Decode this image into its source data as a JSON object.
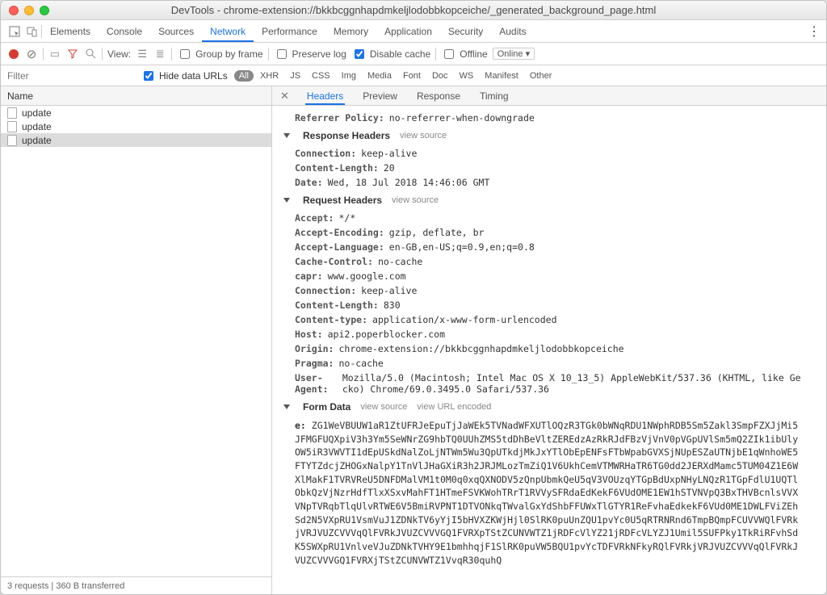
{
  "window": {
    "title": "DevTools - chrome-extension://bkkbcggnhapdmkeljlodobbkopceiche/_generated_background_page.html"
  },
  "main_tabs": [
    "Elements",
    "Console",
    "Sources",
    "Network",
    "Performance",
    "Memory",
    "Application",
    "Security",
    "Audits"
  ],
  "main_active": "Network",
  "toolbar": {
    "view_label": "View:",
    "group_by_frame": "Group by frame",
    "preserve_log": "Preserve log",
    "disable_cache": "Disable cache",
    "offline": "Offline",
    "online": "Online"
  },
  "filter": {
    "placeholder": "Filter",
    "hide_data_urls": "Hide data URLs",
    "types": [
      "All",
      "XHR",
      "JS",
      "CSS",
      "Img",
      "Media",
      "Font",
      "Doc",
      "WS",
      "Manifest",
      "Other"
    ],
    "selected_type": "All"
  },
  "name_header": "Name",
  "requests": [
    "update",
    "update",
    "update"
  ],
  "selected_request_index": 2,
  "status": "3 requests | 360 B transferred",
  "detail_tabs": [
    "Headers",
    "Preview",
    "Response",
    "Timing"
  ],
  "detail_active": "Headers",
  "general": {
    "referrer_policy_k": "Referrer Policy:",
    "referrer_policy_v": "no-referrer-when-downgrade"
  },
  "sections": {
    "response_headers": "Response Headers",
    "request_headers": "Request Headers",
    "form_data": "Form Data",
    "view_source": "view source",
    "view_url_encoded": "view URL encoded"
  },
  "response_headers": [
    {
      "k": "Connection:",
      "v": "keep-alive"
    },
    {
      "k": "Content-Length:",
      "v": "20"
    },
    {
      "k": "Date:",
      "v": "Wed, 18 Jul 2018 14:46:06 GMT"
    }
  ],
  "request_headers": [
    {
      "k": "Accept:",
      "v": "*/*"
    },
    {
      "k": "Accept-Encoding:",
      "v": "gzip, deflate, br"
    },
    {
      "k": "Accept-Language:",
      "v": "en-GB,en-US;q=0.9,en;q=0.8"
    },
    {
      "k": "Cache-Control:",
      "v": "no-cache"
    },
    {
      "k": "capr:",
      "v": "www.google.com"
    },
    {
      "k": "Connection:",
      "v": "keep-alive"
    },
    {
      "k": "Content-Length:",
      "v": "830"
    },
    {
      "k": "Content-type:",
      "v": "application/x-www-form-urlencoded"
    },
    {
      "k": "Host:",
      "v": "api2.poperblocker.com"
    },
    {
      "k": "Origin:",
      "v": "chrome-extension://bkkbcggnhapdmkeljlodobbkopceiche"
    },
    {
      "k": "Pragma:",
      "v": "no-cache"
    },
    {
      "k": "User-Agent:",
      "v": "Mozilla/5.0 (Macintosh; Intel Mac OS X 10_13_5) AppleWebKit/537.36 (KHTML, like Gecko) Chrome/69.0.3495.0 Safari/537.36"
    }
  ],
  "form_data": {
    "field_key": "e:",
    "field_val": "ZG1WeVBUUW1aR1ZtUFRJeEpuTjJaWEk5TVNadWFXUTlOQzR3TGk0bWNqRDU1NWphRDB5Sm5Zakl3SmpFZXJjMi5JFMGFUQXpiV3h3Ym5SeWNrZG9hbTQ0UUhZMS5tdDhBeVltZEREdzAzRkRJdFBzVjVnV0pVGpUVlSm5mQ2ZIk1ibUlyOW5iR3VWVTI1dEpUSkdNalZoLjNTWm5Wu3QpUTkdjMkJxYTlObEpENFsFTbWpabGVXSjNUpESZaUTNjbE1qWnhoWE5FTYTZdcjZHOGxNalpY1TnVlJHaGXiR3h2JRJMLozTmZiQ1V6UkhCemVTMWRHaTR6TG0dd2JERXdMamc5TUM04Z1E6WXlMakF1TVRVReU5DNFDMalVM1t0M0q0xqQXNODV5zQnpUbmkQeU5qV3VOUzqYTGpBdUxpNHyLNQzR1TGpFdlU1UQTlObkQzVjNzrHdfTlxXSxvMahFT1HTmeFSVKWohTRrT1RVVySFRdaEdKekF6VUdOME1EW1hSTVNVpQ3BxTHVBcnlsVVXVNpTVRqbTlqUlvRTWE6V5BmiRVPNT1DTVONkqTWvalGxYdShbFFUWxTlGTYR1ReFvhaEdkekF6VUd0ME1DWLFViZEhSd2N5VXpRU1VsmVuJ1ZDNkTV6yYjI5bHVXZKWjHjl0SlRK0puUnZQU1pvYc0U5qRTRNRnd6TmpBQmpFCUVVWQlFVRkjVRJVUZCVVVqQlFVRkJVUZCVVVGQ1FVRXpTStZCUNVWTZ1jRDFcVlYZ21jRDFcVLYZJ1Umil5SUFPky1TkRiRFvhSdK5SWXpRU1VnlveVJuZDNkTVHY9E1bmhhqjF1SlRK0puVW5BQU1pvYcTDFVRkNFkyRQlFVRkjVRJVUZCVVVqQlFVRkJVUZCVVVGQ1FVRXjTStZCUNVWTZ1VvqR30quhQ"
  }
}
